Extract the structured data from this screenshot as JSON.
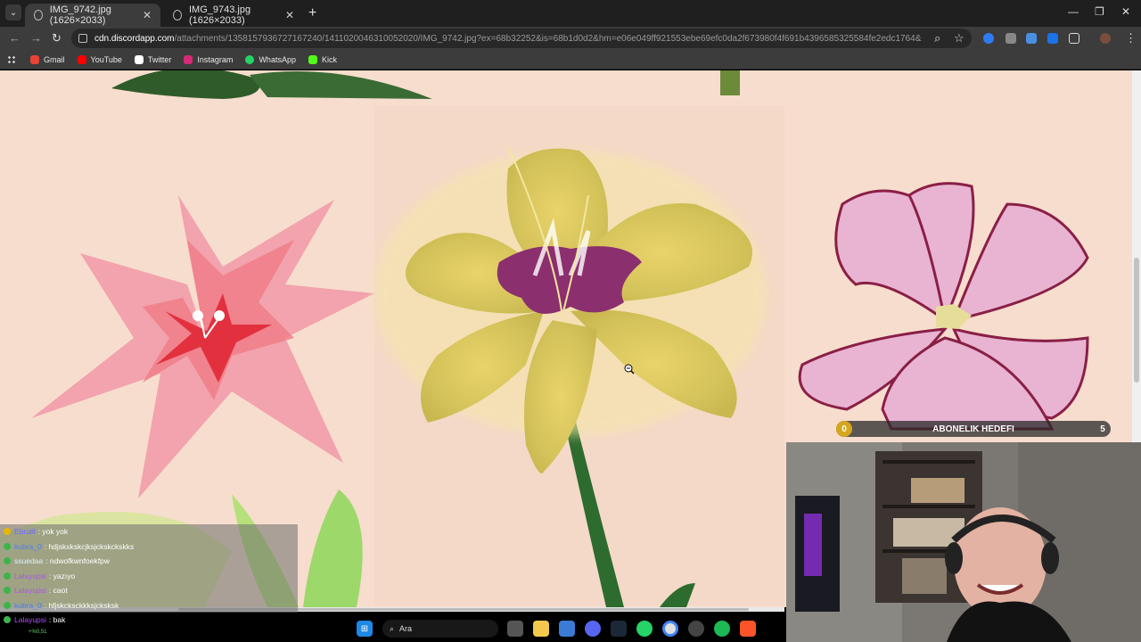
{
  "browser": {
    "tabs": [
      {
        "title": "IMG_9742.jpg (1626×2033)",
        "active": true
      },
      {
        "title": "IMG_9743.jpg (1626×2033)",
        "active": false
      }
    ],
    "url_host": "cdn.discordapp.com",
    "url_path": "/attachments/1358157936727167240/1411020046310052020/IMG_9742.jpg?ex=68b32252&is=68b1d0d2&hm=e06e049ff921553ebe69efc0da2f673980f4f691b4396585325584fe2edc1764&",
    "bookmarks": [
      {
        "label": "Gmail",
        "color": "#ea4335"
      },
      {
        "label": "YouTube",
        "color": "#ff0000"
      },
      {
        "label": "Twitter",
        "color": "#ffffff"
      },
      {
        "label": "Instagram",
        "color": "#d62976"
      },
      {
        "label": "WhatsApp",
        "color": "#25d366"
      },
      {
        "label": "Kick",
        "color": "#53fc18"
      }
    ]
  },
  "overlay": {
    "goal": {
      "start": "0",
      "label": "ABONELIK HEDEFI",
      "end": "5"
    },
    "chat": [
      {
        "user": "Ebrulll",
        "msg": ": yok yok",
        "user_color": "#6b6bff",
        "badge": "#e6b800"
      },
      {
        "user": "kubra_0",
        "msg": ": hdjskxkskcjksjckskckskks",
        "user_color": "#4a7bff",
        "badge": "#3cb44b"
      },
      {
        "user": "ssuedaa",
        "msg": ": ndwofkwnfoekfpw",
        "user_color": "#dff0ff",
        "badge": "#3cb44b"
      },
      {
        "user": "Lalayupsi",
        "msg": ": yazıyo",
        "user_color": "#b34dff",
        "badge": "#3cb44b"
      },
      {
        "user": "Lalayupsi",
        "msg": ": caot",
        "user_color": "#b34dff",
        "badge": "#3cb44b"
      },
      {
        "user": "kubra_0",
        "msg": ": hfjskcksckkksjcksksk",
        "user_color": "#4a7bff",
        "badge": "#3cb44b"
      },
      {
        "user": "Lalayupsi",
        "msg": ": bak",
        "user_color": "#b34dff",
        "badge": "#3cb44b"
      }
    ],
    "chat_sub": "+%0,51"
  },
  "taskbar": {
    "search_label": "Ara"
  }
}
